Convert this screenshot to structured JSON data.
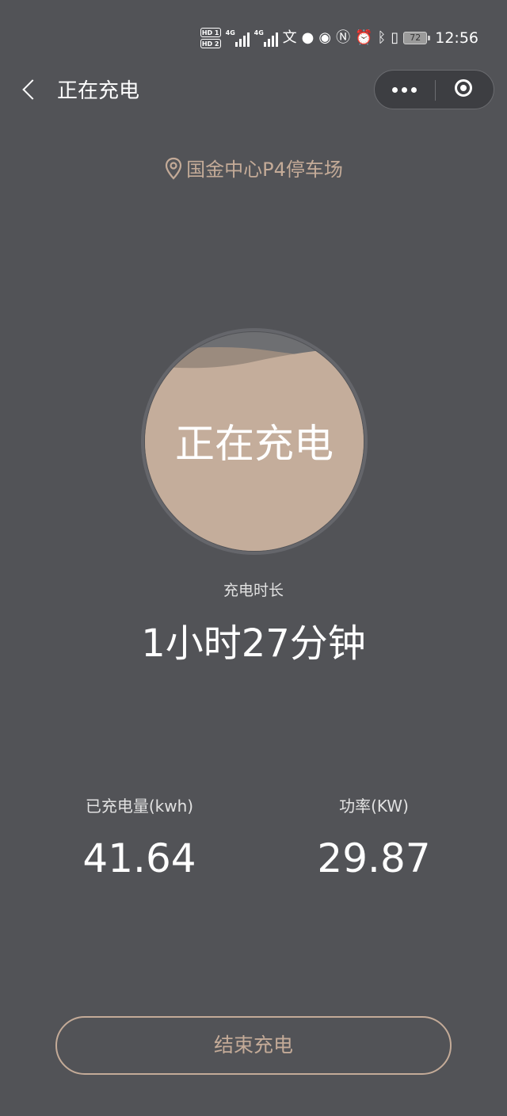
{
  "status_bar": {
    "hd1": "HD 1",
    "hd2": "HD 2",
    "network1": "4G",
    "network2": "4G",
    "battery": "72",
    "time": "12:56",
    "icons": [
      "hd-icon",
      "signal-icon",
      "input-method-icon",
      "message-icon",
      "eye-icon",
      "nfc-icon",
      "alarm-icon",
      "bluetooth-icon",
      "vibrate-icon",
      "battery-icon"
    ]
  },
  "nav": {
    "title": "正在充电"
  },
  "location": {
    "name": "国金中心P4停车场"
  },
  "charging": {
    "status": "正在充电",
    "duration_label": "充电时长",
    "duration_value": "1小时27分钟",
    "level": 0.88
  },
  "stats": {
    "energy_label": "已充电量(kwh)",
    "energy_value": "41.64",
    "power_label": "功率(KW)",
    "power_value": "29.87"
  },
  "actions": {
    "end_label": "结束充电"
  },
  "colors": {
    "background": "#525357",
    "accent": "#c4ab98",
    "fill": "#c4ad9b"
  }
}
